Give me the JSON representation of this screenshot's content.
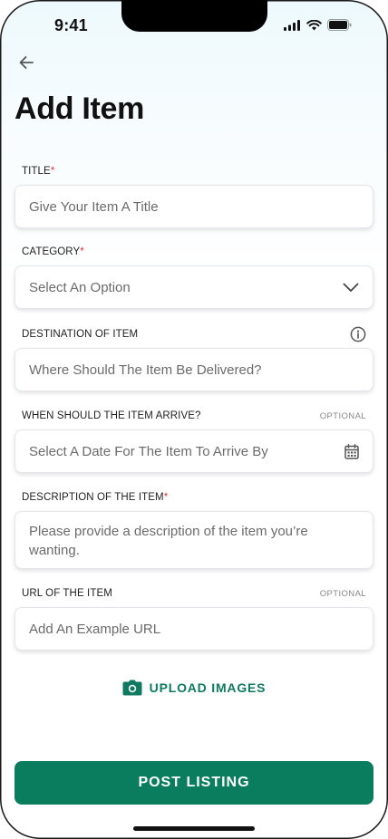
{
  "status_bar": {
    "time": "9:41"
  },
  "header": {
    "back_icon": "arrow-left-icon",
    "title": "Add Item"
  },
  "fields": {
    "title": {
      "label": "TITLE",
      "required_mark": "*",
      "placeholder": "Give Your Item A Title"
    },
    "category": {
      "label": "CATEGORY",
      "required_mark": "*",
      "placeholder": "Select An Option",
      "icon": "chevron-down-icon"
    },
    "destination": {
      "label": "DESTINATION OF ITEM",
      "placeholder": "Where Should The Item Be Delivered?",
      "icon": "info-icon"
    },
    "arrival": {
      "label": "WHEN SHOULD THE ITEM ARRIVE?",
      "optional": "OPTIONAL",
      "placeholder": "Select A Date For The Item To Arrive By",
      "icon": "calendar-icon"
    },
    "description": {
      "label": "DESCRIPTION OF THE ITEM",
      "required_mark": "*",
      "placeholder": "Please provide a description of the item you’re wanting."
    },
    "url": {
      "label": "URL OF THE ITEM",
      "optional": "OPTIONAL",
      "placeholder": "Add An Example URL"
    }
  },
  "upload": {
    "label": "UPLOAD IMAGES",
    "icon": "camera-icon"
  },
  "submit": {
    "label": "POST LISTING"
  },
  "colors": {
    "brand_green": "#0b7d5f",
    "required_red": "#e0333f"
  }
}
